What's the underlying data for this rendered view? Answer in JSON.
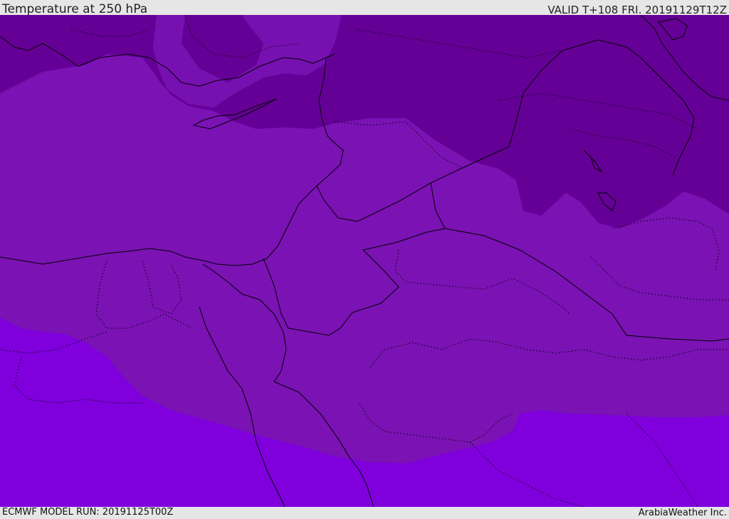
{
  "header": {
    "title": "Temperature at 250 hPa",
    "valid": "VALID T+108 FRI. 20191129T12Z"
  },
  "footer": {
    "model_run": "ECMWF MODEL RUN: 20191125T00Z",
    "credit": "ArabiaWeather Inc."
  },
  "colors": {
    "band_coldest": "#650096",
    "band_cold": "#7310b0",
    "band_mid": "#7a10b2",
    "band_warm": "#7f00dd",
    "coastline": "#000000",
    "frame": "#e6e6e6"
  }
}
